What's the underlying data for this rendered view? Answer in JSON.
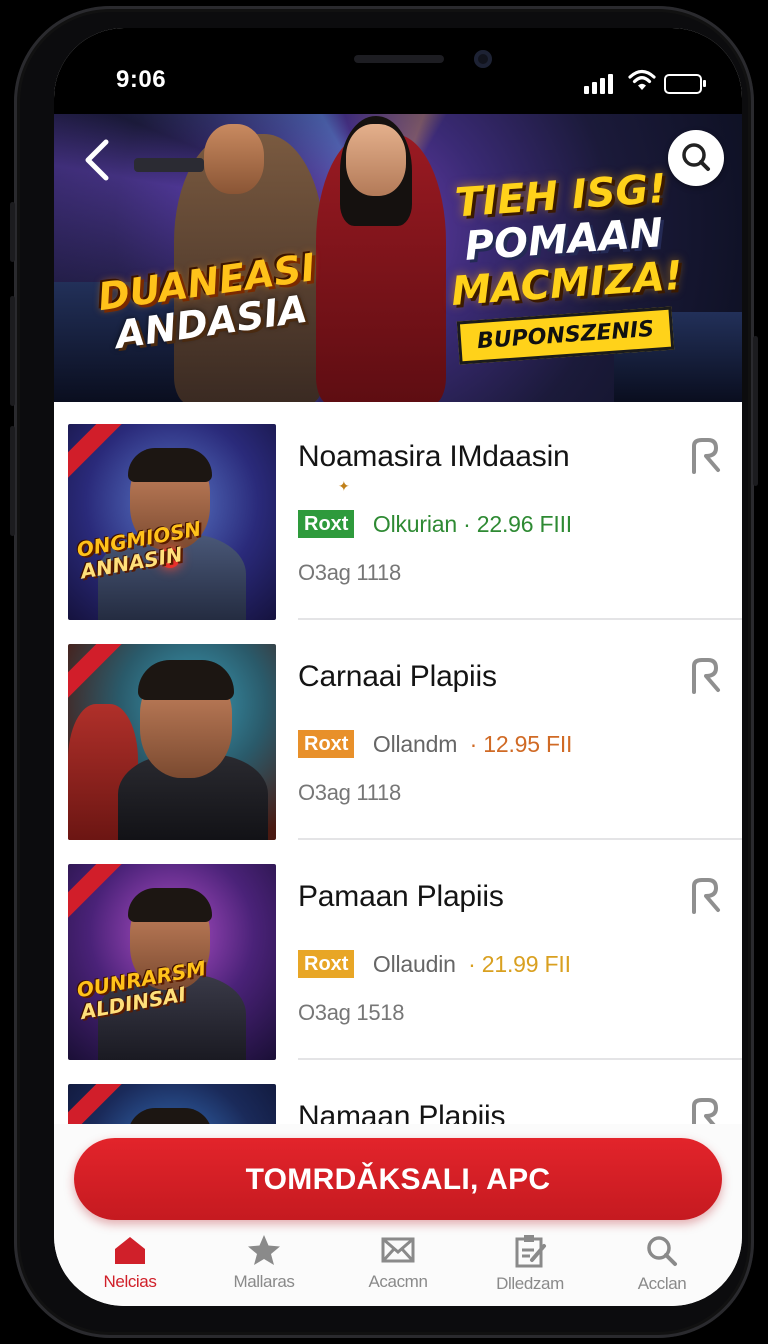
{
  "status_bar": {
    "time": "9:06"
  },
  "banner": {
    "title_left_line1": "DUANEASI",
    "title_left_line2": "ANDASIA",
    "title_right_line1": "TIEH ISG!",
    "title_right_line2": "POMAAN",
    "title_right_line3": "MACMIZA!",
    "tag": "BUPONSZENIS"
  },
  "items": [
    {
      "title": "Noamasira IMdaasin",
      "badge": "Roxt",
      "badge_color": "#2e9a3c",
      "price": "Olkurian · 22.96 FIII",
      "price_color": "#2e8a33",
      "meta": "O3ag  1118",
      "thumb_logo_1": "ONGMIOSN",
      "thumb_logo_2": "ANNASIN"
    },
    {
      "title": "Carnaai Plapiis",
      "badge": "Roxt",
      "badge_color": "#e8902a",
      "price_prefix": "Ollandm",
      "price_value": "· 12.95 FII",
      "price_color": "#d06a25",
      "meta": "O3ag  1118"
    },
    {
      "title": "Pamaan Plapiis",
      "badge": "Roxt",
      "badge_color": "#e8a626",
      "price_prefix": "Ollaudin",
      "price_value": "· 21.99 FII",
      "price_color": "#d9a020",
      "meta": "O3ag  1518",
      "thumb_logo_1": "OUNRARSM",
      "thumb_logo_2": "ALDINSAI"
    },
    {
      "title": "Namaan Plapiis"
    }
  ],
  "cta": {
    "label": "TOMRDǍKSALI, APC"
  },
  "tabs": [
    {
      "label": "Nelcias",
      "icon": "home-icon",
      "active": true
    },
    {
      "label": "Mallaras",
      "icon": "star-icon",
      "active": false
    },
    {
      "label": "Acacmn",
      "icon": "envelope-icon",
      "active": false
    },
    {
      "label": "Dlledzam",
      "icon": "clipboard-icon",
      "active": false
    },
    {
      "label": "Acclan",
      "icon": "search-icon",
      "active": false
    }
  ],
  "colors": {
    "accent": "#d0202a",
    "inactive": "#8a8a8a"
  }
}
